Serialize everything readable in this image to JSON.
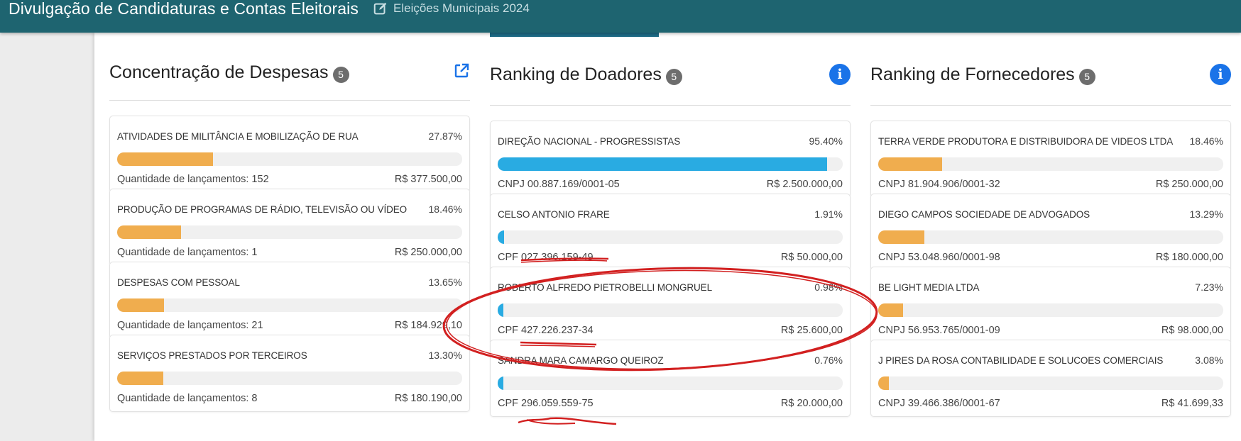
{
  "header": {
    "app_title": "Divulgação de Candidaturas e Contas Eleitorais",
    "election": "Eleições Municipais 2024",
    "bg_color": "#1e6470"
  },
  "colors": {
    "expense_bar": "#f0ad4e",
    "donor_bar": "#29abe2",
    "supplier_bar": "#f0ad4e",
    "info_icon": "#1a73e8",
    "annotation_red": "#d22020"
  },
  "despesas": {
    "title": "Concentração de Despesas",
    "count": "5",
    "icon": "external-link-icon",
    "items": [
      {
        "name": "ATIVIDADES DE MILITÂNCIA E MOBILIZAÇÃO DE RUA",
        "pct": "27.87%",
        "fill": 27.87,
        "left": "Quantidade de lançamentos: 152",
        "value": "R$ 377.500,00"
      },
      {
        "name": "PRODUÇÃO DE PROGRAMAS DE RÁDIO, TELEVISÃO OU VÍDEO",
        "pct": "18.46%",
        "fill": 18.46,
        "left": "Quantidade de lançamentos: 1",
        "value": "R$ 250.000,00"
      },
      {
        "name": "DESPESAS COM PESSOAL",
        "pct": "13.65%",
        "fill": 13.65,
        "left": "Quantidade de lançamentos: 21",
        "value": "R$ 184.929,10"
      },
      {
        "name": "SERVIÇOS PRESTADOS POR TERCEIROS",
        "pct": "13.30%",
        "fill": 13.3,
        "left": "Quantidade de lançamentos: 8",
        "value": "R$ 180.190,00"
      }
    ]
  },
  "doadores": {
    "title": "Ranking de Doadores",
    "count": "5",
    "icon": "info-icon",
    "items": [
      {
        "name": "DIREÇÃO NACIONAL - PROGRESSISTAS",
        "pct": "95.40%",
        "fill": 95.4,
        "left": "CNPJ 00.887.169/0001-05",
        "value": "R$ 2.500.000,00"
      },
      {
        "name": "CELSO ANTONIO FRARE",
        "pct": "1.91%",
        "fill": 1.91,
        "left": "CPF 027.396.159-49",
        "value": "R$ 50.000,00"
      },
      {
        "name": "ROBERTO ALFREDO PIETROBELLI MONGRUEL",
        "pct": "0.98%",
        "fill": 0.98,
        "left": "CPF 427.226.237-34",
        "value": "R$ 25.600,00"
      },
      {
        "name": "SANDRA MARA CAMARGO QUEIROZ",
        "pct": "0.76%",
        "fill": 0.76,
        "left": "CPF 296.059.559-75",
        "value": "R$ 20.000,00"
      }
    ]
  },
  "fornecedores": {
    "title": "Ranking de Fornecedores",
    "count": "5",
    "icon": "info-icon",
    "items": [
      {
        "name": "TERRA VERDE PRODUTORA E DISTRIBUIDORA DE VIDEOS LTDA",
        "pct": "18.46%",
        "fill": 18.46,
        "left": "CNPJ 81.904.906/0001-32",
        "value": "R$ 250.000,00"
      },
      {
        "name": "DIEGO CAMPOS SOCIEDADE DE ADVOGADOS",
        "pct": "13.29%",
        "fill": 13.29,
        "left": "CNPJ 53.048.960/0001-98",
        "value": "R$ 180.000,00"
      },
      {
        "name": "BE LIGHT MEDIA LTDA",
        "pct": "7.23%",
        "fill": 7.23,
        "left": "CNPJ 56.953.765/0001-09",
        "value": "R$ 98.000,00"
      },
      {
        "name": "J PIRES DA ROSA CONTABILIDADE E SOLUCOES COMERCIAIS",
        "pct": "3.08%",
        "fill": 3.08,
        "left": "CNPJ 39.466.386/0001-67",
        "value": "R$ 41.699,33"
      }
    ]
  }
}
